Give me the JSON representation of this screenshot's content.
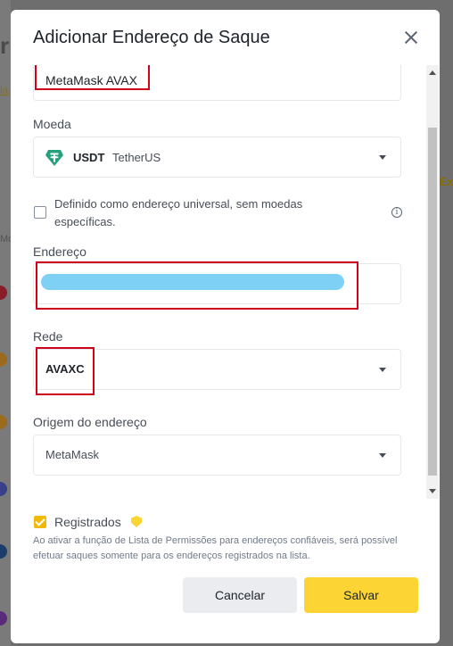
{
  "background": {
    "letter": "r",
    "link": "la",
    "col": "Mo",
    "right_text": "Ex"
  },
  "modal": {
    "title": "Adicionar Endereço de Saque",
    "label_field": {
      "value": "MetaMask AVAX"
    },
    "coin": {
      "label": "Moeda",
      "symbol": "USDT",
      "name": "TetherUS",
      "icon": "tether-icon",
      "icon_color": "#26a17b"
    },
    "universal": {
      "checked": false,
      "text": "Definido como endereço universal, sem moedas específicas."
    },
    "address": {
      "label": "Endereço",
      "value": "",
      "redacted_color": "#7fd0f5"
    },
    "network": {
      "label": "Rede",
      "value": "AVAXC"
    },
    "origin": {
      "label": "Origem do endereço",
      "value": "MetaMask"
    },
    "registered": {
      "checked": true,
      "label": "Registrados",
      "description": "Ao ativar a função de Lista de Permissões para endereços confiáveis, será possível efetuar saques somente para os endereços registrados na lista."
    },
    "buttons": {
      "cancel": "Cancelar",
      "save": "Salvar"
    }
  },
  "colors": {
    "accent": "#fcd535",
    "highlight": "#d0021b"
  }
}
